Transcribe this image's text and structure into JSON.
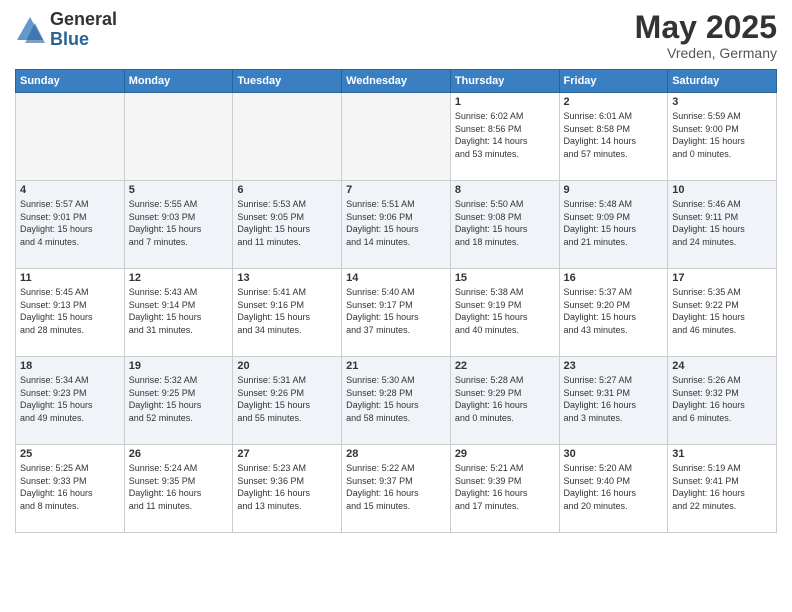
{
  "logo": {
    "general": "General",
    "blue": "Blue"
  },
  "title": "May 2025",
  "location": "Vreden, Germany",
  "weekdays": [
    "Sunday",
    "Monday",
    "Tuesday",
    "Wednesday",
    "Thursday",
    "Friday",
    "Saturday"
  ],
  "weeks": [
    [
      {
        "day": "",
        "info": ""
      },
      {
        "day": "",
        "info": ""
      },
      {
        "day": "",
        "info": ""
      },
      {
        "day": "",
        "info": ""
      },
      {
        "day": "1",
        "info": "Sunrise: 6:02 AM\nSunset: 8:56 PM\nDaylight: 14 hours\nand 53 minutes."
      },
      {
        "day": "2",
        "info": "Sunrise: 6:01 AM\nSunset: 8:58 PM\nDaylight: 14 hours\nand 57 minutes."
      },
      {
        "day": "3",
        "info": "Sunrise: 5:59 AM\nSunset: 9:00 PM\nDaylight: 15 hours\nand 0 minutes."
      }
    ],
    [
      {
        "day": "4",
        "info": "Sunrise: 5:57 AM\nSunset: 9:01 PM\nDaylight: 15 hours\nand 4 minutes."
      },
      {
        "day": "5",
        "info": "Sunrise: 5:55 AM\nSunset: 9:03 PM\nDaylight: 15 hours\nand 7 minutes."
      },
      {
        "day": "6",
        "info": "Sunrise: 5:53 AM\nSunset: 9:05 PM\nDaylight: 15 hours\nand 11 minutes."
      },
      {
        "day": "7",
        "info": "Sunrise: 5:51 AM\nSunset: 9:06 PM\nDaylight: 15 hours\nand 14 minutes."
      },
      {
        "day": "8",
        "info": "Sunrise: 5:50 AM\nSunset: 9:08 PM\nDaylight: 15 hours\nand 18 minutes."
      },
      {
        "day": "9",
        "info": "Sunrise: 5:48 AM\nSunset: 9:09 PM\nDaylight: 15 hours\nand 21 minutes."
      },
      {
        "day": "10",
        "info": "Sunrise: 5:46 AM\nSunset: 9:11 PM\nDaylight: 15 hours\nand 24 minutes."
      }
    ],
    [
      {
        "day": "11",
        "info": "Sunrise: 5:45 AM\nSunset: 9:13 PM\nDaylight: 15 hours\nand 28 minutes."
      },
      {
        "day": "12",
        "info": "Sunrise: 5:43 AM\nSunset: 9:14 PM\nDaylight: 15 hours\nand 31 minutes."
      },
      {
        "day": "13",
        "info": "Sunrise: 5:41 AM\nSunset: 9:16 PM\nDaylight: 15 hours\nand 34 minutes."
      },
      {
        "day": "14",
        "info": "Sunrise: 5:40 AM\nSunset: 9:17 PM\nDaylight: 15 hours\nand 37 minutes."
      },
      {
        "day": "15",
        "info": "Sunrise: 5:38 AM\nSunset: 9:19 PM\nDaylight: 15 hours\nand 40 minutes."
      },
      {
        "day": "16",
        "info": "Sunrise: 5:37 AM\nSunset: 9:20 PM\nDaylight: 15 hours\nand 43 minutes."
      },
      {
        "day": "17",
        "info": "Sunrise: 5:35 AM\nSunset: 9:22 PM\nDaylight: 15 hours\nand 46 minutes."
      }
    ],
    [
      {
        "day": "18",
        "info": "Sunrise: 5:34 AM\nSunset: 9:23 PM\nDaylight: 15 hours\nand 49 minutes."
      },
      {
        "day": "19",
        "info": "Sunrise: 5:32 AM\nSunset: 9:25 PM\nDaylight: 15 hours\nand 52 minutes."
      },
      {
        "day": "20",
        "info": "Sunrise: 5:31 AM\nSunset: 9:26 PM\nDaylight: 15 hours\nand 55 minutes."
      },
      {
        "day": "21",
        "info": "Sunrise: 5:30 AM\nSunset: 9:28 PM\nDaylight: 15 hours\nand 58 minutes."
      },
      {
        "day": "22",
        "info": "Sunrise: 5:28 AM\nSunset: 9:29 PM\nDaylight: 16 hours\nand 0 minutes."
      },
      {
        "day": "23",
        "info": "Sunrise: 5:27 AM\nSunset: 9:31 PM\nDaylight: 16 hours\nand 3 minutes."
      },
      {
        "day": "24",
        "info": "Sunrise: 5:26 AM\nSunset: 9:32 PM\nDaylight: 16 hours\nand 6 minutes."
      }
    ],
    [
      {
        "day": "25",
        "info": "Sunrise: 5:25 AM\nSunset: 9:33 PM\nDaylight: 16 hours\nand 8 minutes."
      },
      {
        "day": "26",
        "info": "Sunrise: 5:24 AM\nSunset: 9:35 PM\nDaylight: 16 hours\nand 11 minutes."
      },
      {
        "day": "27",
        "info": "Sunrise: 5:23 AM\nSunset: 9:36 PM\nDaylight: 16 hours\nand 13 minutes."
      },
      {
        "day": "28",
        "info": "Sunrise: 5:22 AM\nSunset: 9:37 PM\nDaylight: 16 hours\nand 15 minutes."
      },
      {
        "day": "29",
        "info": "Sunrise: 5:21 AM\nSunset: 9:39 PM\nDaylight: 16 hours\nand 17 minutes."
      },
      {
        "day": "30",
        "info": "Sunrise: 5:20 AM\nSunset: 9:40 PM\nDaylight: 16 hours\nand 20 minutes."
      },
      {
        "day": "31",
        "info": "Sunrise: 5:19 AM\nSunset: 9:41 PM\nDaylight: 16 hours\nand 22 minutes."
      }
    ]
  ]
}
